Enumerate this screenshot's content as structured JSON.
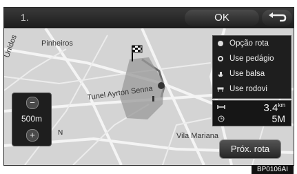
{
  "topbar": {
    "number": "1.",
    "ok_label": "OK",
    "back_icon": "return-arrow-icon"
  },
  "map": {
    "labels": {
      "pinheiros": "Pinheiros",
      "unidos": "Unidos",
      "tunnel": "Tunel Ayrton Senna",
      "vila_mariana": "Vila Mariana"
    },
    "compass": "N",
    "route_color": "#8a8a8a"
  },
  "menu": {
    "items": [
      {
        "label": "Opção rota",
        "icon": "route-option-icon"
      },
      {
        "label": "Use pedágio",
        "icon": "toll-icon"
      },
      {
        "label": "Use balsa",
        "icon": "ferry-icon"
      },
      {
        "label": "Use rodovi",
        "icon": "highway-icon"
      }
    ]
  },
  "info": {
    "distance_value": "3.4",
    "distance_unit": "km",
    "time_value": "5M"
  },
  "zoom": {
    "scale_label": "500m"
  },
  "buttons": {
    "next_route": "Próx. rota"
  },
  "image_code": "BP0106AI"
}
